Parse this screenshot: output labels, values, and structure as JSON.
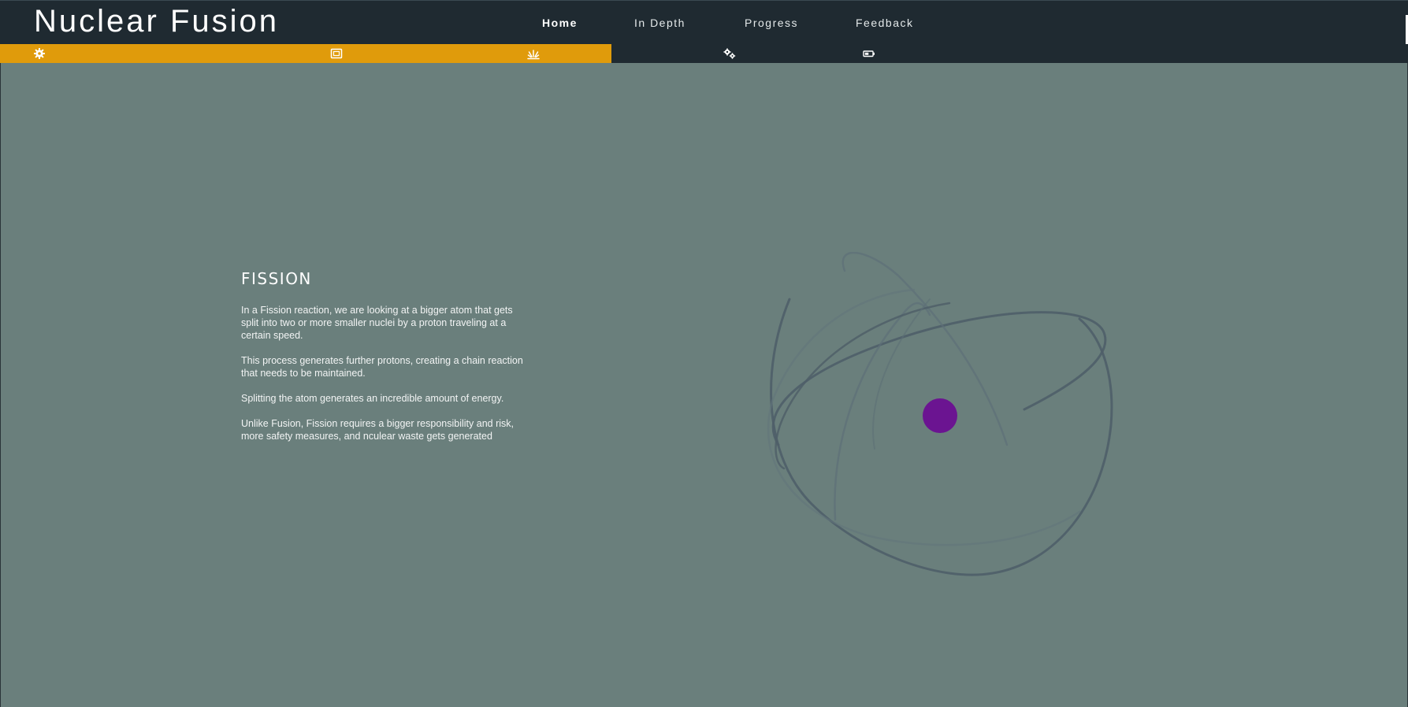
{
  "header": {
    "title": "Nuclear Fusion",
    "nav": [
      {
        "label": "Home",
        "active": true
      },
      {
        "label": "In Depth",
        "active": false
      },
      {
        "label": "Progress",
        "active": false
      },
      {
        "label": "Feedback",
        "active": false
      }
    ]
  },
  "iconbar": {
    "accent_color": "#e09b0b",
    "icons": [
      "gear-icon",
      "scroll-icon",
      "explosion-icon",
      "gears-icon",
      "battery-icon"
    ]
  },
  "main": {
    "heading": "FISSION",
    "paragraphs": [
      "In a Fission reaction, we are looking at a bigger atom that gets split into two or more smaller nuclei by a proton traveling at a certain speed.",
      "This process generates further protons, creating a chain reaction that needs to be maintained.",
      "Splitting the atom generates an incredible amount of energy.",
      "Unlike Fusion, Fission requires a bigger responsibility and risk, more safety measures, and nculear waste gets generated"
    ]
  },
  "graphic": {
    "nucleus_color": "#6b1491",
    "orbit_color": "#4f5f69"
  },
  "colors": {
    "background": "#6a7f7c",
    "header": "#1f2a31"
  }
}
